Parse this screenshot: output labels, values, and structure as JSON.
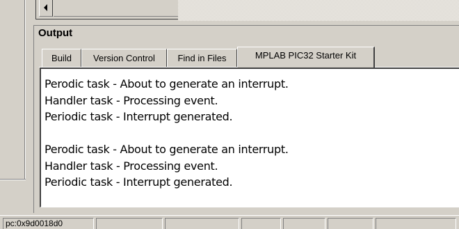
{
  "output_panel": {
    "title": "Output",
    "tabs": [
      {
        "label": "Build"
      },
      {
        "label": "Version Control"
      },
      {
        "label": "Find in Files"
      },
      {
        "label": "MPLAB PIC32 Starter Kit",
        "active": true
      }
    ],
    "lines": [
      "Perodic task - About to generate an interrupt.",
      "Handler task - Processing event.",
      "Periodic task - Interrupt generated.",
      "",
      "Perodic task - About to generate an interrupt.",
      "Handler task - Processing event.",
      "Periodic task - Interrupt generated."
    ]
  },
  "status_bar": {
    "pc": "pc:0x9d0018d0"
  }
}
